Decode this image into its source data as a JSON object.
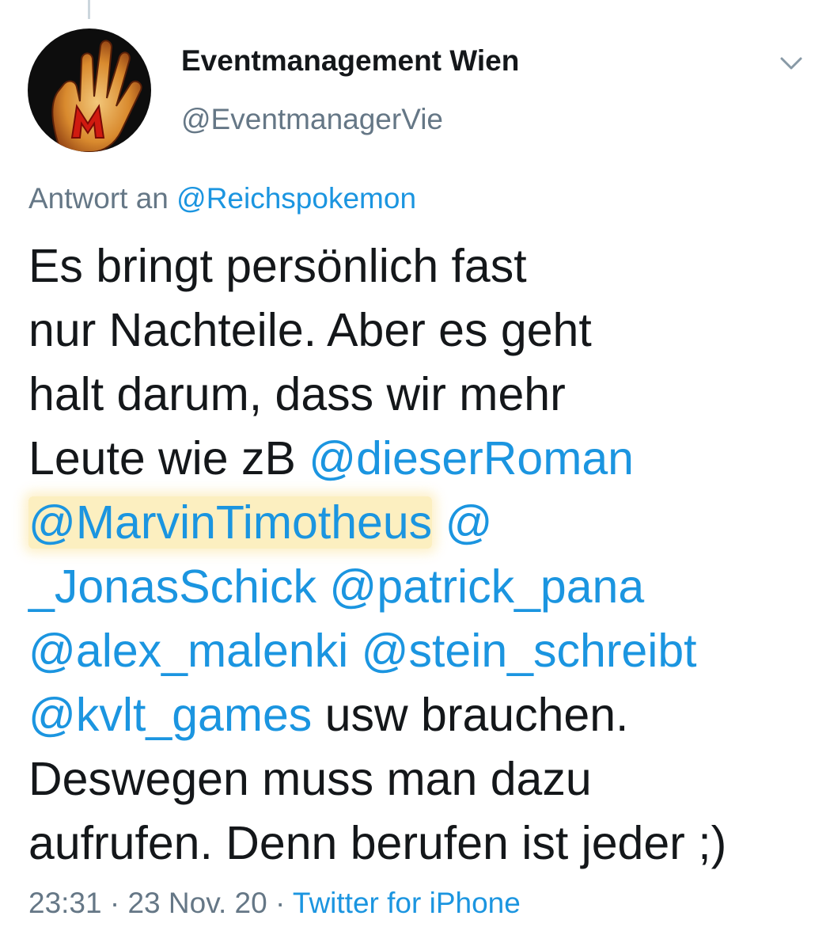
{
  "author": {
    "display_name": "Eventmanagement Wien",
    "handle": "@EventmanagerVie",
    "avatar_icon": "red-hand-m-icon"
  },
  "reply_to": {
    "prefix": "Antwort an",
    "handle": "@Reichspokemon"
  },
  "tweet": {
    "lines": [
      {
        "p1": "Es bringt persönlich fast"
      },
      {
        "p1": "nur Nachteile. Aber es geht"
      },
      {
        "p1": "halt darum, dass wir mehr"
      },
      {
        "p1": "Leute wie zB ",
        "m1": "@dieserRoman"
      },
      {
        "m1": "@MarvinTimotheus",
        "m2": " @"
      },
      {
        "m1": "_JonasSchick",
        "m2": " @patrick_pana"
      },
      {
        "m1": "@alex_malenki",
        "m2": " @stein_schreibt"
      },
      {
        "m1": "@kvlt_games",
        "p2": " usw brauchen."
      },
      {
        "p1": "Deswegen muss man dazu"
      },
      {
        "p1": "aufrufen. Denn berufen ist jeder ;)"
      }
    ]
  },
  "meta": {
    "time": "23:31",
    "sep1": " · ",
    "date": "23 Nov. 20",
    "sep2": " · ",
    "source": "Twitter for iPhone"
  },
  "colors": {
    "link": "#1b95e0",
    "secondary": "#657786",
    "text": "#14171a",
    "highlight": "#fae18c"
  }
}
